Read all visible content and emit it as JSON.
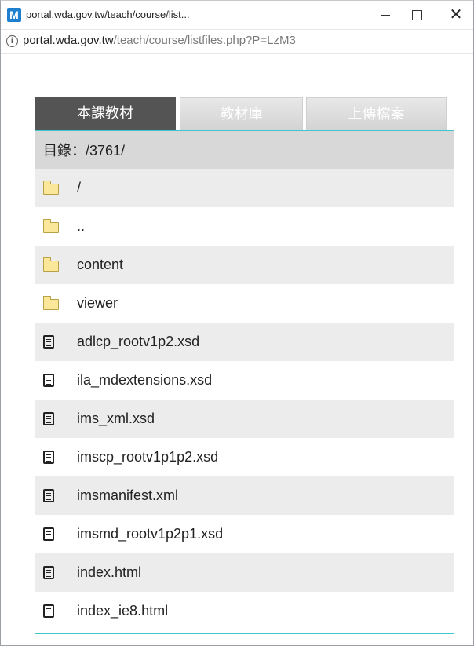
{
  "window": {
    "app_icon": "M",
    "title": "portal.wda.gov.tw/teach/course/list...",
    "minimize_label": "",
    "maximize_label": "",
    "close_label": "✕"
  },
  "address": {
    "host": "portal.wda.gov.tw",
    "path": "/teach/course/listfiles.php?P=LzM3"
  },
  "tabs": [
    {
      "label": "本課教材",
      "active": true
    },
    {
      "label": "教材庫",
      "active": false
    },
    {
      "label": "上傳檔案",
      "active": false
    }
  ],
  "directory": {
    "label": "目錄：/3761/"
  },
  "files": [
    {
      "name": "/",
      "type": "folder"
    },
    {
      "name": "..",
      "type": "folder"
    },
    {
      "name": "content",
      "type": "folder"
    },
    {
      "name": "viewer",
      "type": "folder"
    },
    {
      "name": "adlcp_rootv1p2.xsd",
      "type": "file"
    },
    {
      "name": "ila_mdextensions.xsd",
      "type": "file"
    },
    {
      "name": "ims_xml.xsd",
      "type": "file"
    },
    {
      "name": "imscp_rootv1p1p2.xsd",
      "type": "file"
    },
    {
      "name": "imsmanifest.xml",
      "type": "file"
    },
    {
      "name": "imsmd_rootv1p2p1.xsd",
      "type": "file"
    },
    {
      "name": "index.html",
      "type": "file"
    },
    {
      "name": "index_ie8.html",
      "type": "file"
    }
  ],
  "colors": {
    "active_tab": "#545454",
    "panel_border": "#3fc6cc",
    "header_row": "#d8d8d8",
    "alt_row": "#ececec",
    "folder": "#fbe79a"
  }
}
